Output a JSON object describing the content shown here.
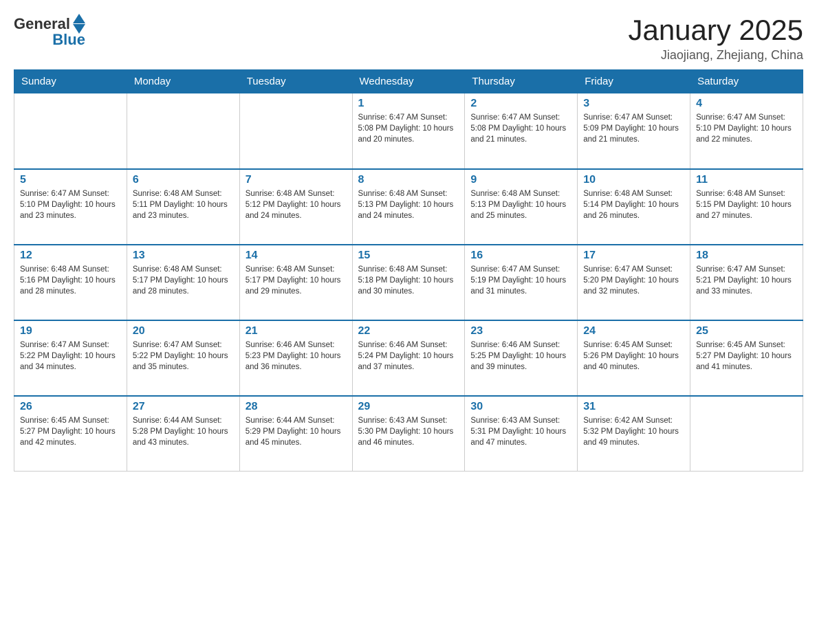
{
  "header": {
    "logo": {
      "text_general": "General",
      "text_blue": "Blue"
    },
    "title": "January 2025",
    "location": "Jiaojiang, Zhejiang, China"
  },
  "days_of_week": [
    "Sunday",
    "Monday",
    "Tuesday",
    "Wednesday",
    "Thursday",
    "Friday",
    "Saturday"
  ],
  "weeks": [
    [
      {
        "day": "",
        "info": ""
      },
      {
        "day": "",
        "info": ""
      },
      {
        "day": "",
        "info": ""
      },
      {
        "day": "1",
        "info": "Sunrise: 6:47 AM\nSunset: 5:08 PM\nDaylight: 10 hours\nand 20 minutes."
      },
      {
        "day": "2",
        "info": "Sunrise: 6:47 AM\nSunset: 5:08 PM\nDaylight: 10 hours\nand 21 minutes."
      },
      {
        "day": "3",
        "info": "Sunrise: 6:47 AM\nSunset: 5:09 PM\nDaylight: 10 hours\nand 21 minutes."
      },
      {
        "day": "4",
        "info": "Sunrise: 6:47 AM\nSunset: 5:10 PM\nDaylight: 10 hours\nand 22 minutes."
      }
    ],
    [
      {
        "day": "5",
        "info": "Sunrise: 6:47 AM\nSunset: 5:10 PM\nDaylight: 10 hours\nand 23 minutes."
      },
      {
        "day": "6",
        "info": "Sunrise: 6:48 AM\nSunset: 5:11 PM\nDaylight: 10 hours\nand 23 minutes."
      },
      {
        "day": "7",
        "info": "Sunrise: 6:48 AM\nSunset: 5:12 PM\nDaylight: 10 hours\nand 24 minutes."
      },
      {
        "day": "8",
        "info": "Sunrise: 6:48 AM\nSunset: 5:13 PM\nDaylight: 10 hours\nand 24 minutes."
      },
      {
        "day": "9",
        "info": "Sunrise: 6:48 AM\nSunset: 5:13 PM\nDaylight: 10 hours\nand 25 minutes."
      },
      {
        "day": "10",
        "info": "Sunrise: 6:48 AM\nSunset: 5:14 PM\nDaylight: 10 hours\nand 26 minutes."
      },
      {
        "day": "11",
        "info": "Sunrise: 6:48 AM\nSunset: 5:15 PM\nDaylight: 10 hours\nand 27 minutes."
      }
    ],
    [
      {
        "day": "12",
        "info": "Sunrise: 6:48 AM\nSunset: 5:16 PM\nDaylight: 10 hours\nand 28 minutes."
      },
      {
        "day": "13",
        "info": "Sunrise: 6:48 AM\nSunset: 5:17 PM\nDaylight: 10 hours\nand 28 minutes."
      },
      {
        "day": "14",
        "info": "Sunrise: 6:48 AM\nSunset: 5:17 PM\nDaylight: 10 hours\nand 29 minutes."
      },
      {
        "day": "15",
        "info": "Sunrise: 6:48 AM\nSunset: 5:18 PM\nDaylight: 10 hours\nand 30 minutes."
      },
      {
        "day": "16",
        "info": "Sunrise: 6:47 AM\nSunset: 5:19 PM\nDaylight: 10 hours\nand 31 minutes."
      },
      {
        "day": "17",
        "info": "Sunrise: 6:47 AM\nSunset: 5:20 PM\nDaylight: 10 hours\nand 32 minutes."
      },
      {
        "day": "18",
        "info": "Sunrise: 6:47 AM\nSunset: 5:21 PM\nDaylight: 10 hours\nand 33 minutes."
      }
    ],
    [
      {
        "day": "19",
        "info": "Sunrise: 6:47 AM\nSunset: 5:22 PM\nDaylight: 10 hours\nand 34 minutes."
      },
      {
        "day": "20",
        "info": "Sunrise: 6:47 AM\nSunset: 5:22 PM\nDaylight: 10 hours\nand 35 minutes."
      },
      {
        "day": "21",
        "info": "Sunrise: 6:46 AM\nSunset: 5:23 PM\nDaylight: 10 hours\nand 36 minutes."
      },
      {
        "day": "22",
        "info": "Sunrise: 6:46 AM\nSunset: 5:24 PM\nDaylight: 10 hours\nand 37 minutes."
      },
      {
        "day": "23",
        "info": "Sunrise: 6:46 AM\nSunset: 5:25 PM\nDaylight: 10 hours\nand 39 minutes."
      },
      {
        "day": "24",
        "info": "Sunrise: 6:45 AM\nSunset: 5:26 PM\nDaylight: 10 hours\nand 40 minutes."
      },
      {
        "day": "25",
        "info": "Sunrise: 6:45 AM\nSunset: 5:27 PM\nDaylight: 10 hours\nand 41 minutes."
      }
    ],
    [
      {
        "day": "26",
        "info": "Sunrise: 6:45 AM\nSunset: 5:27 PM\nDaylight: 10 hours\nand 42 minutes."
      },
      {
        "day": "27",
        "info": "Sunrise: 6:44 AM\nSunset: 5:28 PM\nDaylight: 10 hours\nand 43 minutes."
      },
      {
        "day": "28",
        "info": "Sunrise: 6:44 AM\nSunset: 5:29 PM\nDaylight: 10 hours\nand 45 minutes."
      },
      {
        "day": "29",
        "info": "Sunrise: 6:43 AM\nSunset: 5:30 PM\nDaylight: 10 hours\nand 46 minutes."
      },
      {
        "day": "30",
        "info": "Sunrise: 6:43 AM\nSunset: 5:31 PM\nDaylight: 10 hours\nand 47 minutes."
      },
      {
        "day": "31",
        "info": "Sunrise: 6:42 AM\nSunset: 5:32 PM\nDaylight: 10 hours\nand 49 minutes."
      },
      {
        "day": "",
        "info": ""
      }
    ]
  ]
}
